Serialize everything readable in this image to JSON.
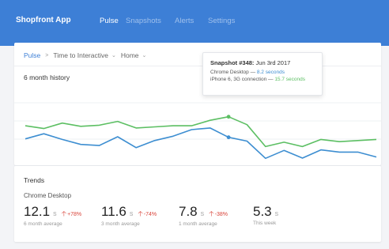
{
  "app": {
    "title": "Shopfront App",
    "nav": [
      "Pulse",
      "Snapshots",
      "Alerts",
      "Settings"
    ],
    "active_nav": "Pulse"
  },
  "breadcrumb": {
    "root": "Pulse",
    "metric": "Time to Interactive",
    "page": "Home"
  },
  "history": {
    "title": "6 month history"
  },
  "tooltip": {
    "snapshot": "Snapshot #348:",
    "date": "Jun 3rd 2017",
    "rows": [
      {
        "label": "Chrome Desktop — ",
        "value": "8.2 seconds"
      },
      {
        "label": "iPhone 6, 3G connection — ",
        "value": "15.7 seconds"
      }
    ]
  },
  "trends": {
    "title": "Trends",
    "subtitle": "Chrome Desktop",
    "metrics": [
      {
        "value": "12.1",
        "unit": "s",
        "change": "+78%",
        "label": "6 month average"
      },
      {
        "value": "11.6",
        "unit": "s",
        "change": "-74%",
        "label": "3 month average"
      },
      {
        "value": "7.8",
        "unit": "s",
        "change": "-38%",
        "label": "1 month average"
      },
      {
        "value": "5.3",
        "unit": "s",
        "change": "",
        "label": "This week"
      }
    ]
  },
  "colors": {
    "header": "#3d7fd6",
    "series_chrome": "#3d8ed1",
    "series_iphone": "#5cbf63",
    "negative": "#d9443a"
  },
  "chart_data": {
    "type": "line",
    "title": "6 month history",
    "x": [
      1,
      2,
      3,
      4,
      5,
      6,
      7,
      8,
      9,
      10,
      11,
      12,
      13,
      14,
      15,
      16,
      17,
      18,
      19,
      20
    ],
    "series": [
      {
        "name": "iPhone 6, 3G connection",
        "values": [
          12.4,
          11.4,
          13.4,
          12.2,
          12.6,
          14.0,
          11.6,
          12.0,
          12.4,
          12.4,
          14.4,
          15.7,
          12.8,
          4.8,
          6.4,
          4.8,
          7.4,
          6.6,
          7.0,
          7.4
        ]
      },
      {
        "name": "Chrome Desktop",
        "values": [
          7.6,
          9.5,
          7.4,
          5.6,
          5.2,
          8.4,
          4.4,
          7.0,
          8.6,
          11.0,
          11.6,
          8.2,
          6.8,
          0.5,
          3.4,
          0.6,
          3.6,
          2.8,
          2.8,
          1.0
        ]
      }
    ],
    "highlight_index": 11,
    "ylim": [
      -2,
      26
    ],
    "grid": true
  }
}
